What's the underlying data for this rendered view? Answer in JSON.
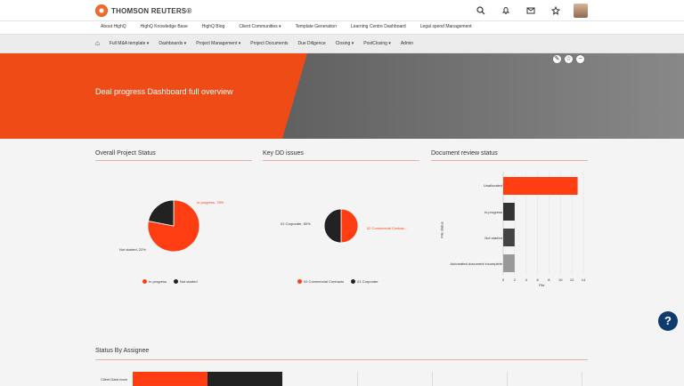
{
  "brand": {
    "name": "THOMSON REUTERS®",
    "accent": "#ef4b16"
  },
  "top_icons": [
    "search-icon",
    "bell-icon",
    "mail-icon",
    "star-icon",
    "avatar"
  ],
  "primary_nav": [
    {
      "label": "About HighQ"
    },
    {
      "label": "HighQ Knowledge Base"
    },
    {
      "label": "HighQ Blog"
    },
    {
      "label": "Client Communities",
      "dropdown": true
    },
    {
      "label": "Template Generation"
    },
    {
      "label": "Learning Centre Dashboard"
    },
    {
      "label": "Legal spend Management"
    }
  ],
  "secondary_nav": [
    {
      "label": "Full M&A template",
      "dropdown": true
    },
    {
      "label": "Dashboards",
      "dropdown": true
    },
    {
      "label": "Project Management",
      "dropdown": true
    },
    {
      "label": "Project Documents"
    },
    {
      "label": "Due Diligence"
    },
    {
      "label": "Closing",
      "dropdown": true
    },
    {
      "label": "PostClosing",
      "dropdown": true
    },
    {
      "label": "Admin"
    }
  ],
  "hero": {
    "title": "Deal progress Dashboard full overview"
  },
  "panels": {
    "overall": {
      "title": "Overall Project Status",
      "slice1": "In progress, 78%",
      "slice2": "Not started, 22%",
      "legend1": "In progress",
      "legend2": "Not started"
    },
    "dd": {
      "title": "Key DD issues",
      "slice1": "01 Corporate, 50%",
      "slice2": "02 Commercial Contrac...",
      "legend1": "02 Commercial Contracts",
      "legend2": "01 Corporate"
    },
    "review": {
      "title": "Document review status",
      "ylabel": "File status",
      "xlabel": "File"
    }
  },
  "status": {
    "title": "Status By Assignee",
    "row": "Client Data room"
  },
  "chart_data": [
    {
      "type": "pie",
      "title": "Overall Project Status",
      "labels": [
        "In progress",
        "Not started"
      ],
      "values": [
        78,
        22
      ],
      "colors": [
        "#ff3d12",
        "#222222"
      ]
    },
    {
      "type": "pie",
      "title": "Key DD issues",
      "labels": [
        "02 Commercial Contracts",
        "01 Corporate"
      ],
      "values": [
        50,
        50
      ],
      "colors": [
        "#ff3d12",
        "#222222"
      ]
    },
    {
      "type": "bar",
      "title": "Document review status",
      "categories": [
        "Unallocated",
        "In progress",
        "Not started",
        "Automated document incomplete"
      ],
      "values": [
        13,
        2,
        2,
        2
      ],
      "colors": [
        "#ff3d12",
        "#333333",
        "#444444",
        "#999999"
      ],
      "xlabel": "File",
      "ylabel": "File status",
      "xlim": [
        0,
        14
      ],
      "xticks": [
        0,
        2,
        4,
        6,
        8,
        10,
        12,
        14
      ]
    }
  ]
}
